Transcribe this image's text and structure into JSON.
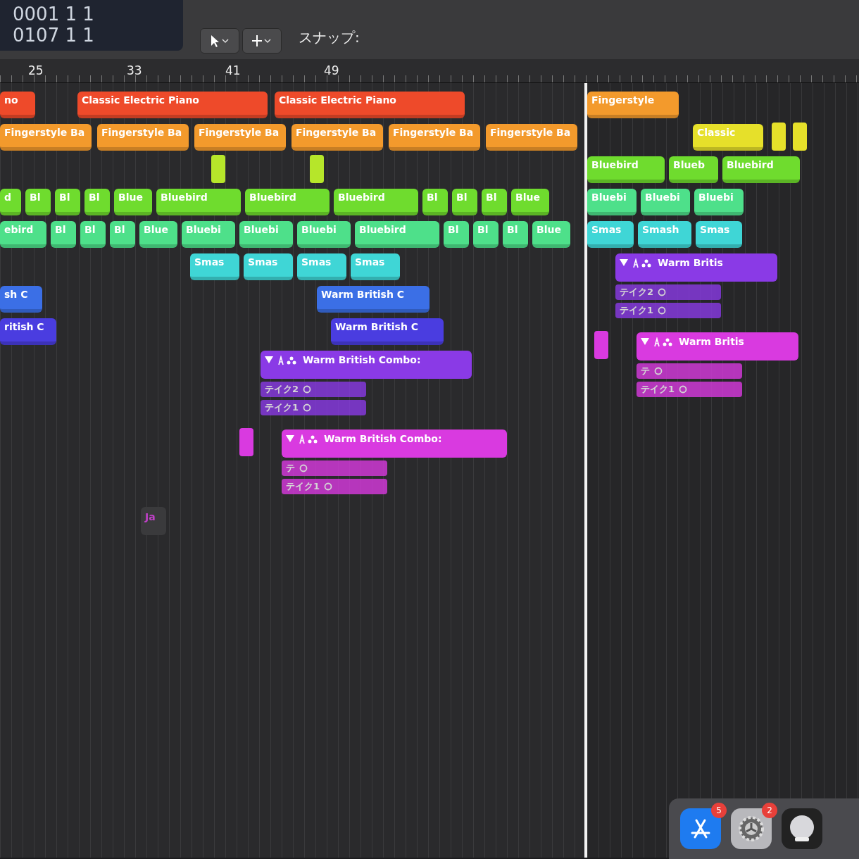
{
  "transport": {
    "lcd_rows": [
      "0001 1 1",
      "0107 1 1"
    ]
  },
  "toolbar": {
    "snap_label": "スナップ:"
  },
  "ruler": {
    "marks": [
      "25",
      "33",
      "41",
      "49"
    ]
  },
  "arrange": {
    "tracks": [
      {
        "color": "#ee4a2a",
        "regions": [
          {
            "kind": "region",
            "label": "no"
          },
          {
            "kind": "region",
            "label": "Classic Electric Piano"
          },
          {
            "kind": "region",
            "label": "Classic Electric Piano"
          }
        ]
      },
      {
        "color": "#f39a2c",
        "regions": [
          {
            "kind": "region",
            "label": "Fingerstyle Ba"
          },
          {
            "kind": "region",
            "label": "Fingerstyle Ba"
          },
          {
            "kind": "region",
            "label": "Fingerstyle Ba"
          },
          {
            "kind": "region",
            "label": "Fingerstyle Ba"
          },
          {
            "kind": "region",
            "label": "Fingerstyle Ba"
          },
          {
            "kind": "region",
            "label": "Fingerstyle Ba"
          }
        ]
      },
      {
        "color": "#b6e62a",
        "regions": [
          {
            "kind": "marker"
          },
          {
            "kind": "marker"
          }
        ]
      },
      {
        "color": "#6fdc2e",
        "regions": [
          {
            "kind": "region",
            "label": "d"
          },
          {
            "kind": "region",
            "label": "Bl"
          },
          {
            "kind": "region",
            "label": "Bl"
          },
          {
            "kind": "region",
            "label": "Bl"
          },
          {
            "kind": "region",
            "label": "Blue"
          },
          {
            "kind": "region",
            "label": "Bluebird"
          },
          {
            "kind": "region",
            "label": "Bluebird"
          },
          {
            "kind": "region",
            "label": "Bluebird"
          },
          {
            "kind": "region",
            "label": "Bl"
          },
          {
            "kind": "region",
            "label": "Bl"
          },
          {
            "kind": "region",
            "label": "Bl"
          },
          {
            "kind": "region",
            "label": "Blue"
          }
        ]
      },
      {
        "color": "#4ee08a",
        "regions": [
          {
            "kind": "region",
            "label": "ebird"
          },
          {
            "kind": "region",
            "label": "Bl"
          },
          {
            "kind": "region",
            "label": "Bl"
          },
          {
            "kind": "region",
            "label": "Bl"
          },
          {
            "kind": "region",
            "label": "Blue"
          },
          {
            "kind": "region",
            "label": "Bluebi"
          },
          {
            "kind": "region",
            "label": "Bluebi"
          },
          {
            "kind": "region",
            "label": "Bluebi"
          },
          {
            "kind": "region",
            "label": "Bluebird"
          },
          {
            "kind": "region",
            "label": "Bl"
          },
          {
            "kind": "region",
            "label": "Bl"
          },
          {
            "kind": "region",
            "label": "Bl"
          },
          {
            "kind": "region",
            "label": "Blue"
          }
        ]
      },
      {
        "color": "#3fd6d6",
        "regions": [
          {
            "kind": "region",
            "label": "Smas"
          },
          {
            "kind": "region",
            "label": "Smas"
          },
          {
            "kind": "region",
            "label": "Smas"
          },
          {
            "kind": "region",
            "label": "Smas"
          }
        ]
      },
      {
        "color": "#3b6fe6",
        "regions": [
          {
            "kind": "region",
            "label": "sh C"
          },
          {
            "kind": "region",
            "label": "Warm British C"
          }
        ]
      },
      {
        "color": "#4a3de0",
        "regions": [
          {
            "kind": "region",
            "label": "ritish C"
          },
          {
            "kind": "region",
            "label": "Warm British C"
          }
        ]
      },
      {
        "color": "#8a3ae6",
        "regions": [
          {
            "kind": "take-folder",
            "label": "Warm British Combo:",
            "takes": [
              "テイク2",
              "テイク1"
            ]
          }
        ]
      },
      {
        "color": "#d93ae0",
        "regions": [
          {
            "kind": "marker"
          },
          {
            "kind": "take-folder",
            "label": "Warm British Combo:",
            "takes": [
              "テ",
              "テイク1"
            ]
          }
        ]
      },
      {
        "color": "#c040c8",
        "regions": [
          {
            "kind": "chip",
            "label": "Ja"
          }
        ]
      }
    ]
  },
  "second_window": {
    "tracks": [
      {
        "color": "#f39a2c",
        "regions": [
          {
            "kind": "region",
            "label": "Fingerstyle"
          }
        ]
      },
      {
        "color": "#e6e02a",
        "regions": [
          {
            "kind": "region",
            "label": "Classic"
          },
          {
            "kind": "marker"
          },
          {
            "kind": "marker"
          }
        ]
      },
      {
        "color": "#6fdc2e",
        "regions": [
          {
            "kind": "region",
            "label": "Bluebird"
          },
          {
            "kind": "region",
            "label": "Blueb"
          },
          {
            "kind": "region",
            "label": "Bluebird"
          }
        ]
      },
      {
        "color": "#4ee08a",
        "regions": [
          {
            "kind": "region",
            "label": "Bluebi"
          },
          {
            "kind": "region",
            "label": "Bluebi"
          },
          {
            "kind": "region",
            "label": "Bluebi"
          }
        ]
      },
      {
        "color": "#3fd6d6",
        "regions": [
          {
            "kind": "region",
            "label": "Smas"
          },
          {
            "kind": "region",
            "label": "Smash"
          },
          {
            "kind": "region",
            "label": "Smas"
          }
        ]
      },
      {
        "color": "#8a3ae6",
        "regions": [
          {
            "kind": "take-folder",
            "label": "Warm Britis",
            "takes": [
              "テイク2",
              "テイク1"
            ]
          }
        ]
      },
      {
        "color": "#d93ae0",
        "regions": [
          {
            "kind": "marker"
          },
          {
            "kind": "take-folder",
            "label": "Warm Britis",
            "takes": [
              "テ",
              "テイク1"
            ]
          }
        ]
      }
    ]
  },
  "dock": {
    "items": [
      {
        "kind": "app-store",
        "badge": "5"
      },
      {
        "kind": "settings",
        "badge": "2"
      },
      {
        "kind": "disk"
      }
    ]
  }
}
